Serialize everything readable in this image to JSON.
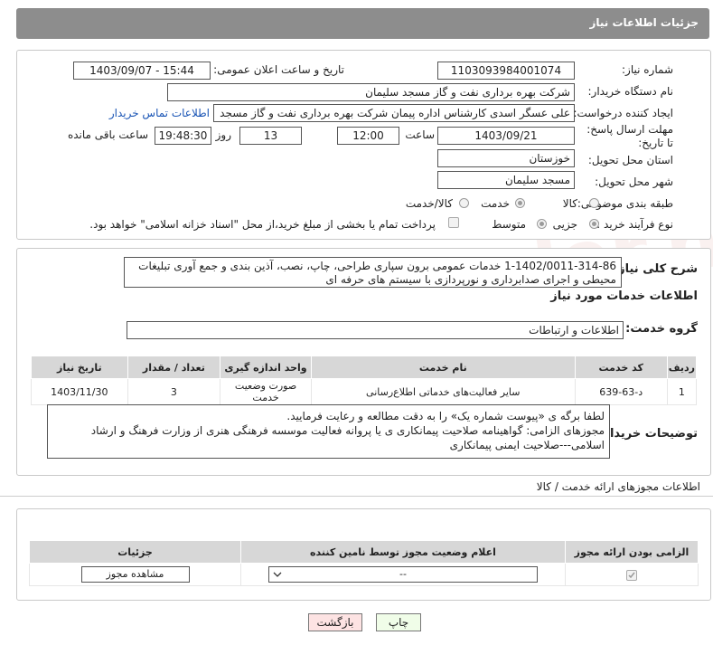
{
  "header": {
    "title": "جزئیات اطلاعات نیاز"
  },
  "watermark": "AriaTender.net",
  "form": {
    "need_number_label": "شماره نیاز:",
    "need_number": "1103093984001074",
    "announce_label": "تاریخ و ساعت اعلان عمومی:",
    "announce_value": "1403/09/07 - 15:44",
    "buyer_label": "نام دستگاه خریدار:",
    "buyer_value": "شرکت بهره برداری نفت و گاز مسجد سلیمان",
    "creator_label": "ایجاد کننده درخواست:",
    "creator_value": "علی عسگر اسدی کارشناس اداره پیمان  شرکت بهره برداری نفت و گاز مسجد",
    "contact_link": "اطلاعات تماس خریدار",
    "deadline_label": "مهلت ارسال پاسخ: تا تاریخ:",
    "deadline_date": "1403/09/21",
    "hour_label": "ساعت",
    "deadline_time": "12:00",
    "days_value": "13",
    "days_label": "روز و",
    "remain_time": "19:48:30",
    "remain_label": "ساعت باقی مانده",
    "province_label": "استان محل تحویل:",
    "province_value": "خوزستان",
    "city_label": "شهر محل تحویل:",
    "city_value": "مسجد سلیمان",
    "category_label": "طبقه بندی موضوعی:",
    "category_options": [
      "کالا",
      "خدمت",
      "کالا/خدمت"
    ],
    "process_label": "نوع فرآیند خرید :",
    "process_options": [
      "جزیی",
      "متوسط"
    ],
    "payment_note": "پرداخت تمام یا بخشی از مبلغ خرید،از محل \"اسناد خزانه اسلامی\" خواهد بود."
  },
  "description": {
    "label": "شرح کلی نیاز:",
    "text": "1-1402/0011-314-86 خدمات عمومی برون سپاری طراحی، چاپ، نصب، آذین بندی و جمع آوری تبلیغات محیطی و اجرای صدابرداری و نورپردازی با سیستم های حرفه ای"
  },
  "services": {
    "section_title": "اطلاعات خدمات مورد نیاز",
    "group_label": "گروه خدمت:",
    "group_value": "اطلاعات و ارتباطات",
    "columns": [
      "ردیف",
      "کد خدمت",
      "نام خدمت",
      "واحد اندازه گیری",
      "تعداد / مقدار",
      "تاریخ نیاز"
    ],
    "rows": [
      [
        "1",
        "د-63-639",
        "سایر فعالیت‌های خدماتی اطلاع‌رسانی",
        "صورت وضعیت خدمت",
        "3",
        "1403/11/30"
      ]
    ]
  },
  "buyer_notes": {
    "label": "توضیحات خریدار:",
    "lines": [
      "لطفا برگه ی «پیوست شماره یک» را به دقت مطالعه و رعایت فرمایید.",
      "مجوزهای الزامی: گواهینامه صلاحیت پیمانکاری  ی یا  پروانه فعالیت موسسه فرهنگی هنری از وزارت فرهنگ و ارشاد",
      "اسلامی---صلاحیت ایمنی پیمانکاری"
    ]
  },
  "permits": {
    "title": "اطلاعات مجوزهای ارائه خدمت / کالا",
    "columns": [
      "الزامی بودن ارائه مجوز",
      "اعلام وضعیت مجوز توسط نامین کننده",
      "جزئیات"
    ],
    "select_value": "--",
    "view_button": "مشاهده مجوز"
  },
  "buttons": {
    "print": "چاپ",
    "back": "بازگشت"
  },
  "colors": {
    "header": "#8d8d8d",
    "table_header": "#d7d7d7",
    "link": "#1a55b5",
    "back_button": "#fde3e3",
    "print_button": "#f0fde8"
  }
}
